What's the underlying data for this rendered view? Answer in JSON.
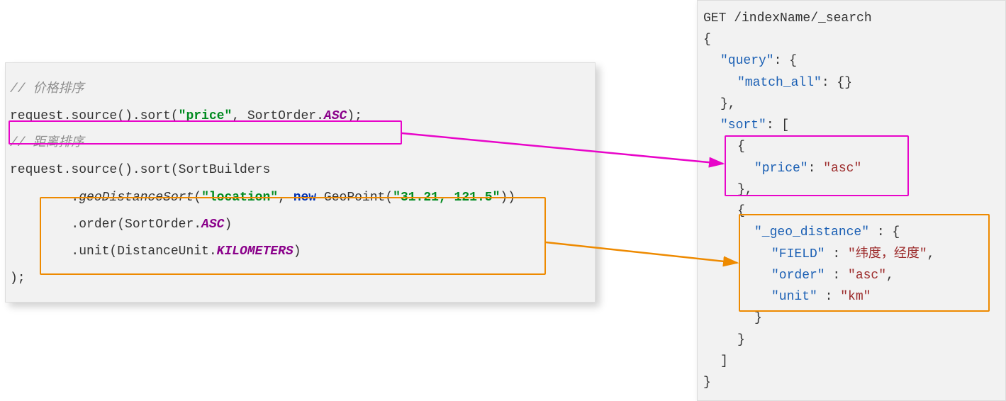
{
  "left": {
    "comment_price": "// 价格排序",
    "line1_a": "request.source().sort(",
    "line1_str": "\"price\"",
    "line1_b": ", SortOrder.",
    "line1_enum": "ASC",
    "line1_c": ");",
    "comment_distance": "// 距离排序",
    "line2": "request.source().sort(SortBuilders",
    "line3_a": "        .",
    "line3_m": "geoDistanceSort",
    "line3_b": "(",
    "line3_str1": "\"location\"",
    "line3_c": ", ",
    "line3_kw": "new",
    "line3_d": " GeoPoint(",
    "line3_str2": "\"31.21, 121.5\"",
    "line3_e": "))",
    "line4_a": "        .order(SortOrder.",
    "line4_enum": "ASC",
    "line4_b": ")",
    "line5_a": "        .unit(DistanceUnit.",
    "line5_enum": "KILOMETERS",
    "line5_b": ")",
    "line6": ");"
  },
  "right": {
    "l0": "GET /indexName/_search",
    "l1": "{",
    "l2_k": "\"query\"",
    "l2_p": ": {",
    "l3_k": "\"match_all\"",
    "l3_p": ": {}",
    "l4": "},",
    "l5_k": "\"sort\"",
    "l5_p": ": [",
    "l6": "{",
    "l7_k": "\"price\"",
    "l7_p": ": ",
    "l7_v": "\"asc\"",
    "l8": "},",
    "l9": "{",
    "l10_k": "\"_geo_distance\"",
    "l10_p": " : {",
    "l11_k": "\"FIELD\"",
    "l11_p": " : ",
    "l11_v": "\"纬度，经度\"",
    "l11_c": ",",
    "l12_k": "\"order\"",
    "l12_p": " : ",
    "l12_v": "\"asc\"",
    "l12_c": ",",
    "l13_k": "\"unit\"",
    "l13_p": " : ",
    "l13_v": "\"km\"",
    "l14": "}",
    "l15": "}",
    "l16": "]",
    "l17": "}"
  }
}
